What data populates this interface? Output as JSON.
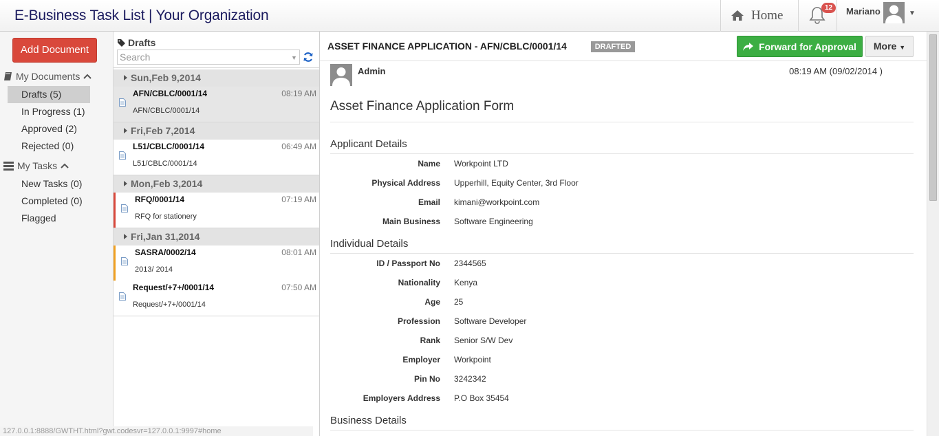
{
  "app": {
    "title": "E-Business Task List | Your Organization"
  },
  "topnav": {
    "home_label": "Home",
    "notifications_count": "12",
    "user_name": "Mariano"
  },
  "sidebar": {
    "add_document_label": "Add Document",
    "my_documents": {
      "label": "My Documents",
      "items": [
        {
          "label": "Drafts (5)",
          "active": true
        },
        {
          "label": "In Progress (1)"
        },
        {
          "label": "Approved (2)"
        },
        {
          "label": "Rejected (0)"
        }
      ]
    },
    "my_tasks": {
      "label": "My Tasks",
      "items": [
        {
          "label": "New Tasks (0)"
        },
        {
          "label": "Completed (0)"
        },
        {
          "label": "Flagged"
        }
      ]
    }
  },
  "list": {
    "header": "Drafts",
    "search_placeholder": "Search",
    "groups": [
      {
        "date": "Sun,Feb 9,2014",
        "rows": [
          {
            "title": "AFN/CBLC/0001/14",
            "time": "08:19 AM",
            "sub": "AFN/CBLC/0001/14",
            "selected": true,
            "flag": ""
          }
        ]
      },
      {
        "date": "Fri,Feb 7,2014",
        "rows": [
          {
            "title": "L51/CBLC/0001/14",
            "time": "06:49 AM",
            "sub": "L51/CBLC/0001/14",
            "flag": ""
          }
        ]
      },
      {
        "date": "Mon,Feb 3,2014",
        "rows": [
          {
            "title": "RFQ/0001/14",
            "time": "07:19 AM",
            "sub": "RFQ for stationery",
            "flag": "#d9483b"
          }
        ]
      },
      {
        "date": "Fri,Jan 31,2014",
        "rows": [
          {
            "title": "SASRA/0002/14",
            "time": "08:01 AM",
            "sub": "2013/ 2014",
            "flag": "#f0a020"
          },
          {
            "title": "Request/+7+/0001/14",
            "time": "07:50 AM",
            "sub": "Request/+7+/0001/14",
            "flag": ""
          }
        ]
      }
    ]
  },
  "document": {
    "title": "ASSET FINANCE APPLICATION -  AFN/CBLC/0001/14",
    "status": "DRAFTED",
    "forward_label": "Forward for Approval",
    "more_label": "More",
    "author": "Admin",
    "timestamp": "08:19 AM (09/02/2014 )",
    "form_title": "Asset Finance Application Form",
    "applicant": {
      "title": "Applicant Details",
      "fields": [
        {
          "label": "Name",
          "value": "Workpoint LTD"
        },
        {
          "label": "Physical Address",
          "value": "Upperhill, Equity Center, 3rd Floor"
        },
        {
          "label": "Email",
          "value": "kimani@workpoint.com"
        },
        {
          "label": "Main Business",
          "value": "Software Engineering"
        }
      ]
    },
    "individual": {
      "title": "Individual Details",
      "fields": [
        {
          "label": "ID / Passport No",
          "value": "2344565"
        },
        {
          "label": "Nationality",
          "value": "Kenya"
        },
        {
          "label": "Age",
          "value": "25"
        },
        {
          "label": "Profession",
          "value": "Software Developer"
        },
        {
          "label": "Rank",
          "value": "Senior S/W Dev"
        },
        {
          "label": "Employer",
          "value": "Workpoint"
        },
        {
          "label": "Pin No",
          "value": "3242342"
        },
        {
          "label": "Employers Address",
          "value": "P.O Box 35454"
        }
      ]
    },
    "business": {
      "title": "Business Details"
    }
  },
  "statusbar": {
    "url": "127.0.0.1:8888/GWTHT.html?gwt.codesvr=127.0.0.1:9997#home"
  },
  "colors": {
    "accent_green": "#3cae43",
    "accent_red": "#d9483b",
    "flag_orange": "#f0a020"
  }
}
